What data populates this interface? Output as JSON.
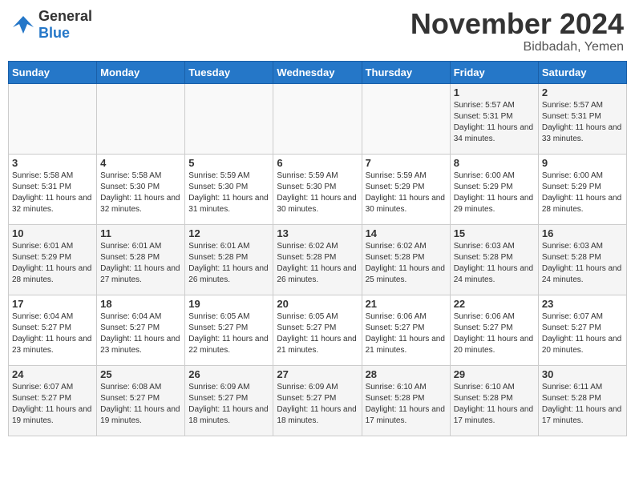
{
  "logo": {
    "general": "General",
    "blue": "Blue"
  },
  "header": {
    "month": "November 2024",
    "location": "Bidbadah, Yemen"
  },
  "weekdays": [
    "Sunday",
    "Monday",
    "Tuesday",
    "Wednesday",
    "Thursday",
    "Friday",
    "Saturday"
  ],
  "weeks": [
    [
      {
        "day": "",
        "info": ""
      },
      {
        "day": "",
        "info": ""
      },
      {
        "day": "",
        "info": ""
      },
      {
        "day": "",
        "info": ""
      },
      {
        "day": "",
        "info": ""
      },
      {
        "day": "1",
        "info": "Sunrise: 5:57 AM\nSunset: 5:31 PM\nDaylight: 11 hours and 34 minutes."
      },
      {
        "day": "2",
        "info": "Sunrise: 5:57 AM\nSunset: 5:31 PM\nDaylight: 11 hours and 33 minutes."
      }
    ],
    [
      {
        "day": "3",
        "info": "Sunrise: 5:58 AM\nSunset: 5:31 PM\nDaylight: 11 hours and 32 minutes."
      },
      {
        "day": "4",
        "info": "Sunrise: 5:58 AM\nSunset: 5:30 PM\nDaylight: 11 hours and 32 minutes."
      },
      {
        "day": "5",
        "info": "Sunrise: 5:59 AM\nSunset: 5:30 PM\nDaylight: 11 hours and 31 minutes."
      },
      {
        "day": "6",
        "info": "Sunrise: 5:59 AM\nSunset: 5:30 PM\nDaylight: 11 hours and 30 minutes."
      },
      {
        "day": "7",
        "info": "Sunrise: 5:59 AM\nSunset: 5:29 PM\nDaylight: 11 hours and 30 minutes."
      },
      {
        "day": "8",
        "info": "Sunrise: 6:00 AM\nSunset: 5:29 PM\nDaylight: 11 hours and 29 minutes."
      },
      {
        "day": "9",
        "info": "Sunrise: 6:00 AM\nSunset: 5:29 PM\nDaylight: 11 hours and 28 minutes."
      }
    ],
    [
      {
        "day": "10",
        "info": "Sunrise: 6:01 AM\nSunset: 5:29 PM\nDaylight: 11 hours and 28 minutes."
      },
      {
        "day": "11",
        "info": "Sunrise: 6:01 AM\nSunset: 5:28 PM\nDaylight: 11 hours and 27 minutes."
      },
      {
        "day": "12",
        "info": "Sunrise: 6:01 AM\nSunset: 5:28 PM\nDaylight: 11 hours and 26 minutes."
      },
      {
        "day": "13",
        "info": "Sunrise: 6:02 AM\nSunset: 5:28 PM\nDaylight: 11 hours and 26 minutes."
      },
      {
        "day": "14",
        "info": "Sunrise: 6:02 AM\nSunset: 5:28 PM\nDaylight: 11 hours and 25 minutes."
      },
      {
        "day": "15",
        "info": "Sunrise: 6:03 AM\nSunset: 5:28 PM\nDaylight: 11 hours and 24 minutes."
      },
      {
        "day": "16",
        "info": "Sunrise: 6:03 AM\nSunset: 5:28 PM\nDaylight: 11 hours and 24 minutes."
      }
    ],
    [
      {
        "day": "17",
        "info": "Sunrise: 6:04 AM\nSunset: 5:27 PM\nDaylight: 11 hours and 23 minutes."
      },
      {
        "day": "18",
        "info": "Sunrise: 6:04 AM\nSunset: 5:27 PM\nDaylight: 11 hours and 23 minutes."
      },
      {
        "day": "19",
        "info": "Sunrise: 6:05 AM\nSunset: 5:27 PM\nDaylight: 11 hours and 22 minutes."
      },
      {
        "day": "20",
        "info": "Sunrise: 6:05 AM\nSunset: 5:27 PM\nDaylight: 11 hours and 21 minutes."
      },
      {
        "day": "21",
        "info": "Sunrise: 6:06 AM\nSunset: 5:27 PM\nDaylight: 11 hours and 21 minutes."
      },
      {
        "day": "22",
        "info": "Sunrise: 6:06 AM\nSunset: 5:27 PM\nDaylight: 11 hours and 20 minutes."
      },
      {
        "day": "23",
        "info": "Sunrise: 6:07 AM\nSunset: 5:27 PM\nDaylight: 11 hours and 20 minutes."
      }
    ],
    [
      {
        "day": "24",
        "info": "Sunrise: 6:07 AM\nSunset: 5:27 PM\nDaylight: 11 hours and 19 minutes."
      },
      {
        "day": "25",
        "info": "Sunrise: 6:08 AM\nSunset: 5:27 PM\nDaylight: 11 hours and 19 minutes."
      },
      {
        "day": "26",
        "info": "Sunrise: 6:09 AM\nSunset: 5:27 PM\nDaylight: 11 hours and 18 minutes."
      },
      {
        "day": "27",
        "info": "Sunrise: 6:09 AM\nSunset: 5:27 PM\nDaylight: 11 hours and 18 minutes."
      },
      {
        "day": "28",
        "info": "Sunrise: 6:10 AM\nSunset: 5:28 PM\nDaylight: 11 hours and 17 minutes."
      },
      {
        "day": "29",
        "info": "Sunrise: 6:10 AM\nSunset: 5:28 PM\nDaylight: 11 hours and 17 minutes."
      },
      {
        "day": "30",
        "info": "Sunrise: 6:11 AM\nSunset: 5:28 PM\nDaylight: 11 hours and 17 minutes."
      }
    ]
  ]
}
